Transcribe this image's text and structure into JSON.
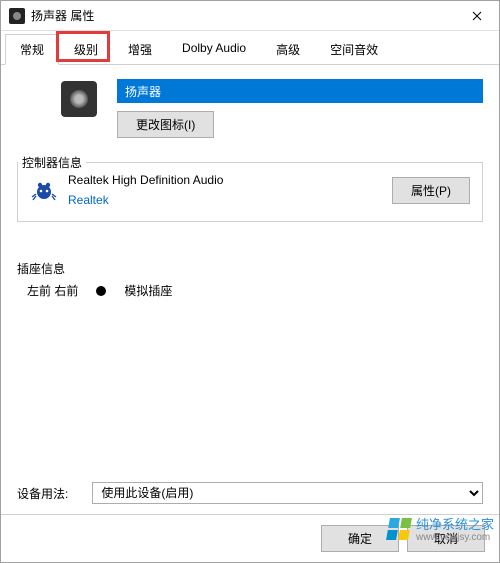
{
  "window": {
    "title": "扬声器 属性"
  },
  "tabs": {
    "items": [
      {
        "label": "常规"
      },
      {
        "label": "级别"
      },
      {
        "label": "增强"
      },
      {
        "label": "Dolby Audio"
      },
      {
        "label": "高级"
      },
      {
        "label": "空间音效"
      }
    ],
    "active_index": 0,
    "highlighted_index": 1
  },
  "general": {
    "device_name": "扬声器",
    "change_icon_label": "更改图标(I)"
  },
  "controller": {
    "group_label": "控制器信息",
    "name": "Realtek High Definition Audio",
    "vendor": "Realtek",
    "properties_button": "属性(P)"
  },
  "jack": {
    "group_label": "插座信息",
    "location": "左前 右前",
    "type": "模拟插座"
  },
  "usage": {
    "label": "设备用法:",
    "selected": "使用此设备(启用)"
  },
  "footer": {
    "ok": "确定",
    "cancel": "取消"
  },
  "watermark": {
    "text": "纯净系统之家",
    "url": "www.ycwjsy.com"
  }
}
